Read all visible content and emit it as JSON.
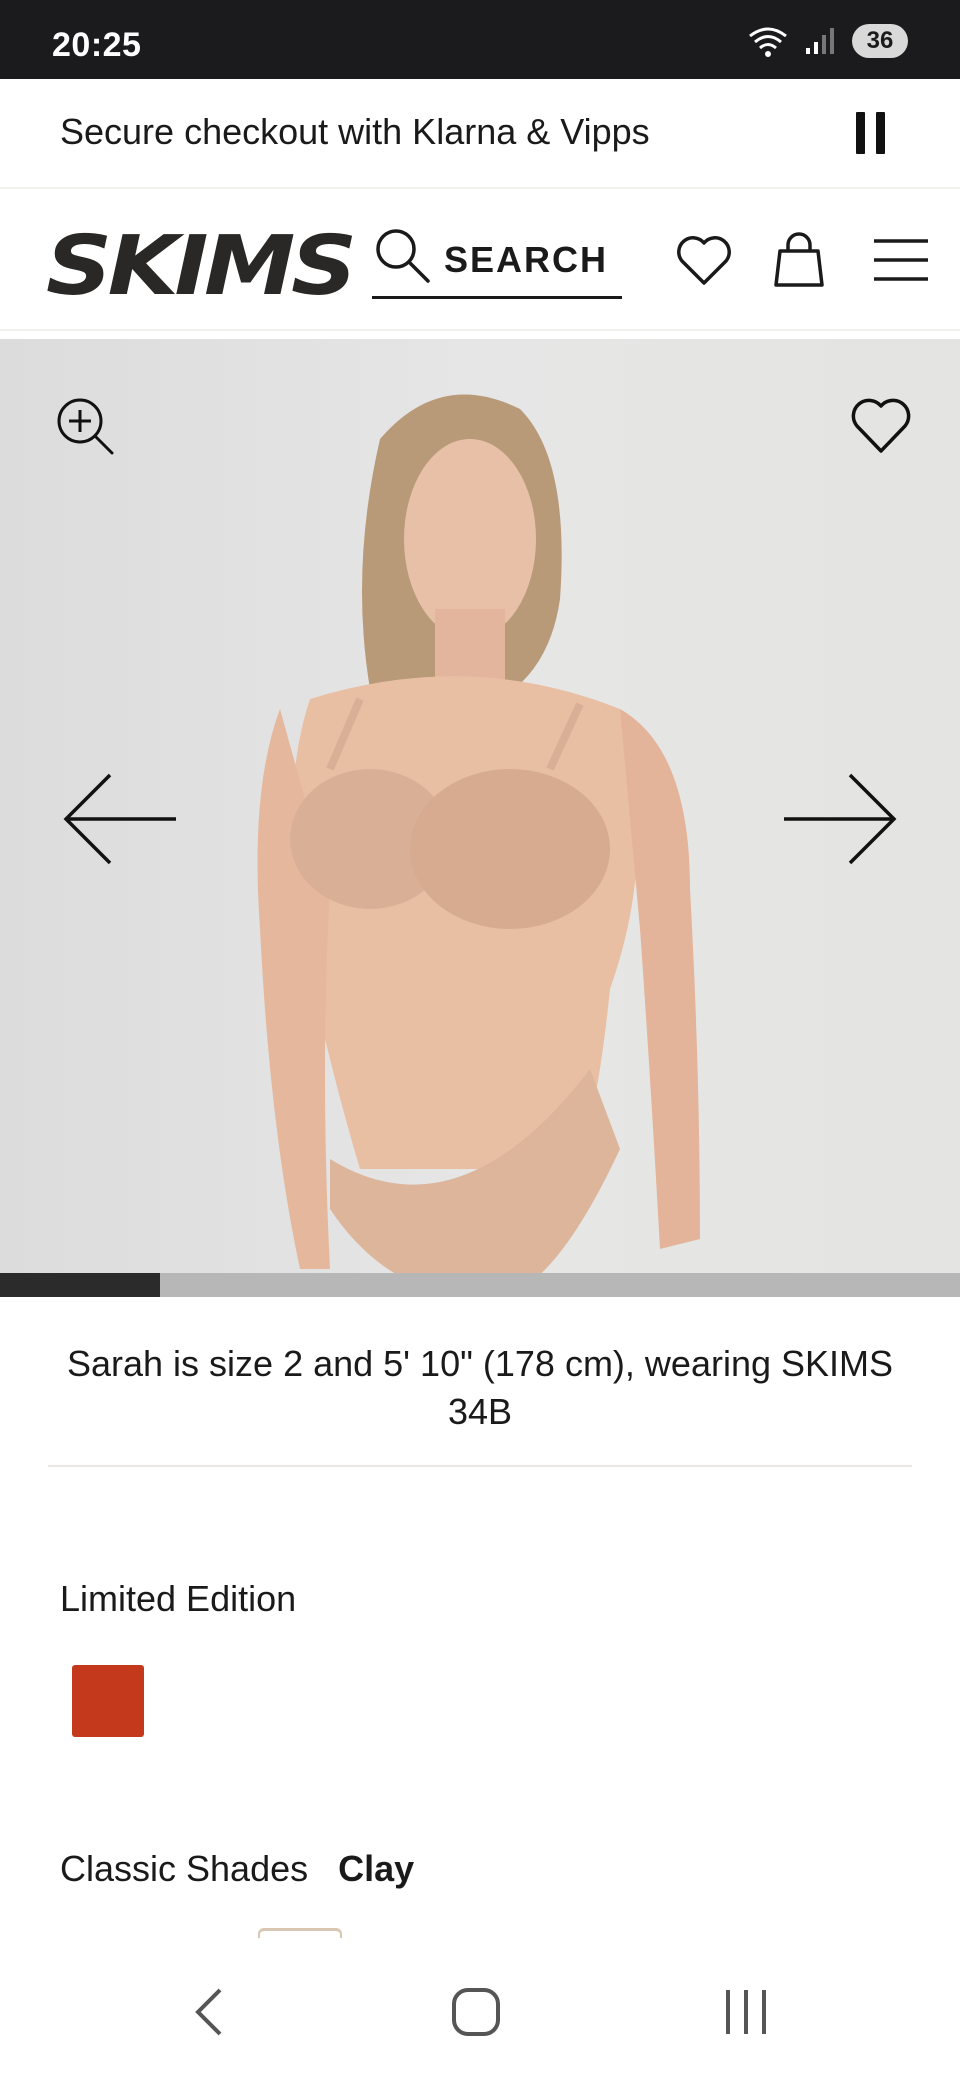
{
  "status_bar": {
    "time": "20:25",
    "battery": "36"
  },
  "promo": {
    "text": "Secure checkout with Klarna & Vipps"
  },
  "header": {
    "logo": "SKIMS",
    "search_label": "SEARCH"
  },
  "hero": {
    "slide_progress": 0.167
  },
  "model_caption": "Sarah is size 2 and 5' 10\" (178 cm), wearing SKIMS 34B",
  "colors_section": {
    "limited_label": "Limited Edition",
    "limited_swatch": "#c4391b",
    "classic_label": "Classic Shades",
    "classic_selected": "Clay"
  },
  "icons": [
    "wifi-icon",
    "signal-icon",
    "pause-icon",
    "search-icon",
    "heart-icon",
    "bag-icon",
    "menu-icon",
    "zoom-in-icon",
    "arrow-left-icon",
    "arrow-right-icon"
  ]
}
